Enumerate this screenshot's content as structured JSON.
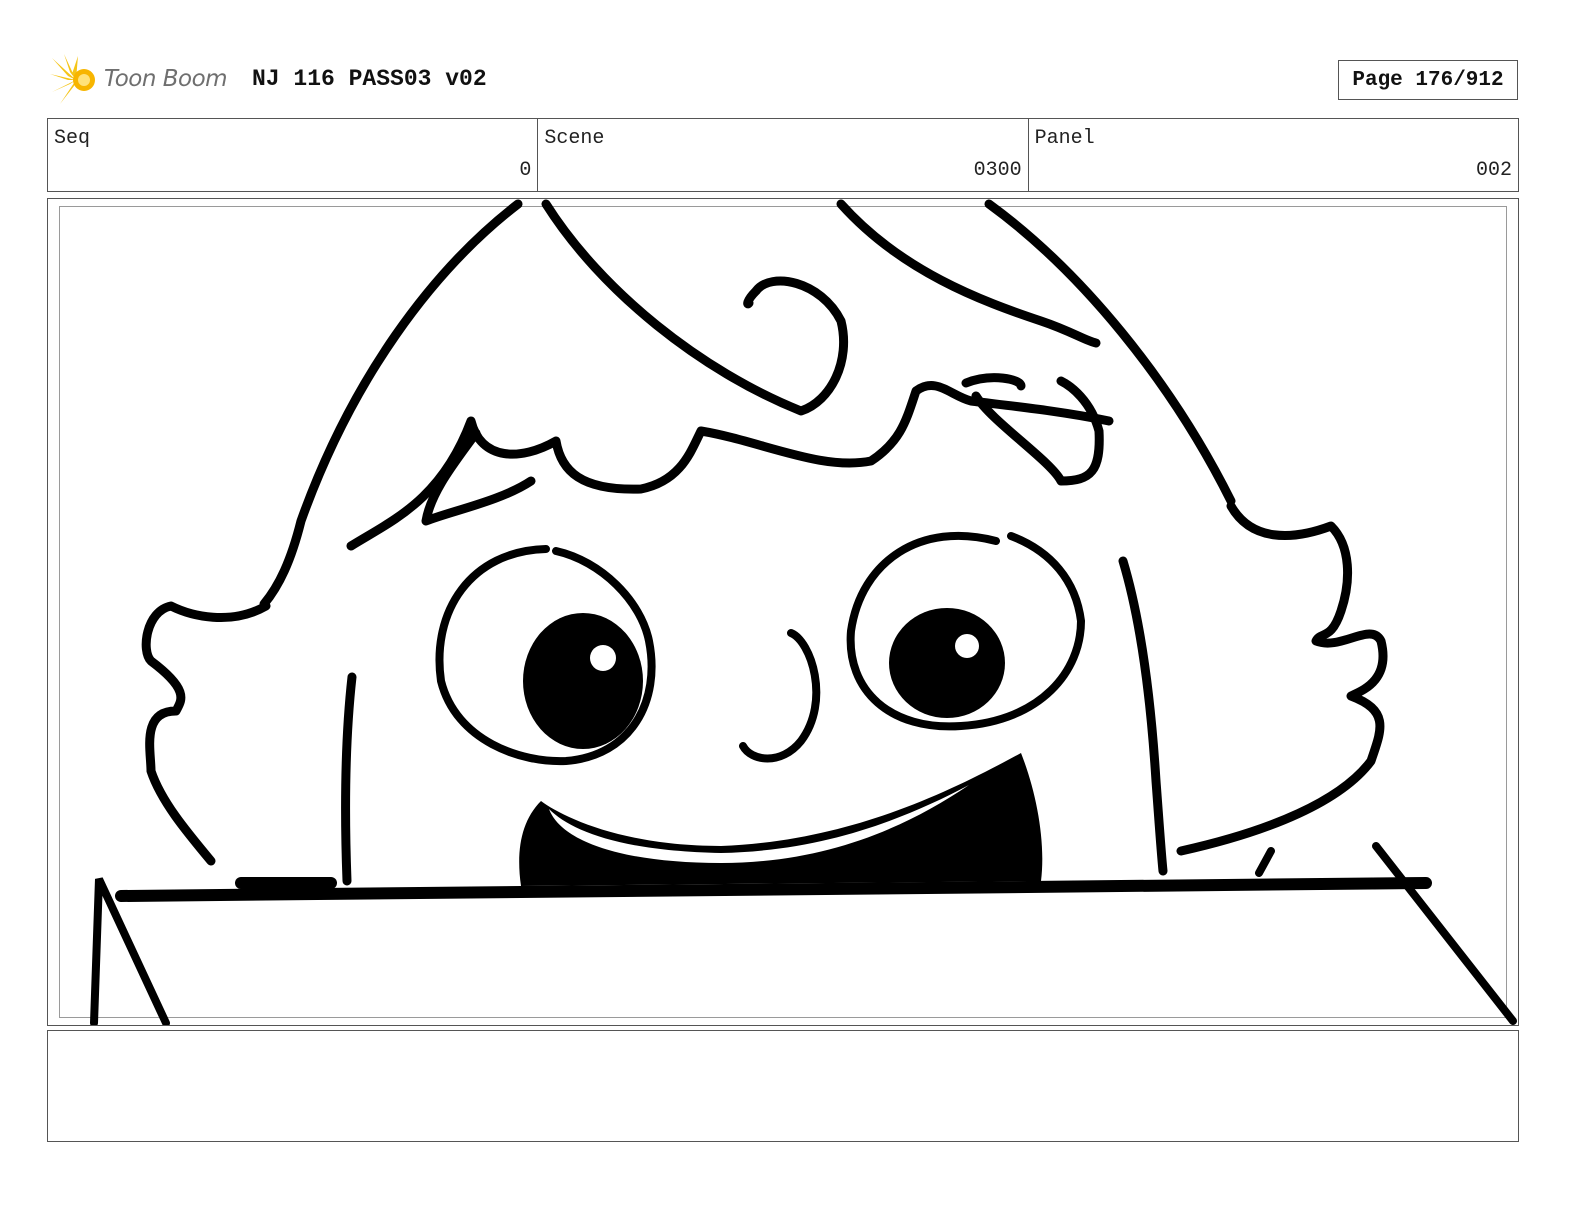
{
  "header": {
    "logo_text": "Toon Boom",
    "title": "NJ 116 PASS03 v02",
    "page_label": "Page 176/912"
  },
  "info": {
    "seq_label": "Seq",
    "seq_value": "0",
    "scene_label": "Scene",
    "scene_value": "0300",
    "panel_label": "Panel",
    "panel_value": "002"
  },
  "notes": {
    "text": ""
  },
  "colors": {
    "logo_star": "#f5c518",
    "logo_text": "#6f6f6f",
    "border": "#555555",
    "ink": "#000000"
  }
}
